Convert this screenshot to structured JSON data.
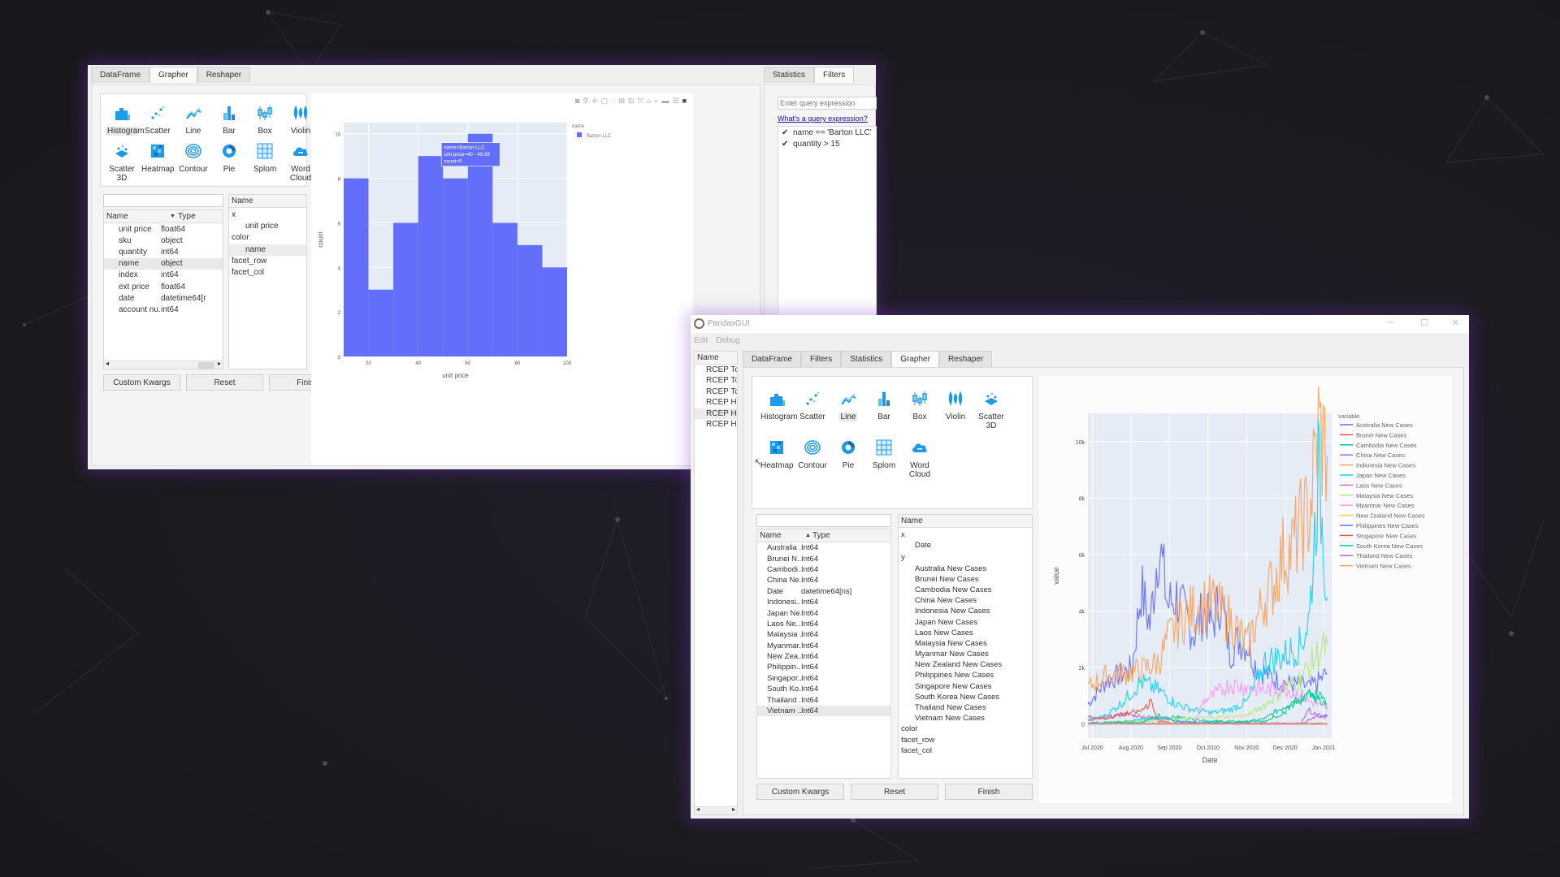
{
  "window1": {
    "tabs": [
      {
        "label": "DataFrame",
        "active": false
      },
      {
        "label": "Grapher",
        "active": true
      },
      {
        "label": "Reshaper",
        "active": false
      }
    ],
    "right_tabs": [
      {
        "label": "Statistics",
        "active": false
      },
      {
        "label": "Filters",
        "active": true
      }
    ],
    "chart_types": [
      {
        "label": "Histogram",
        "icon": "histogram-icon",
        "selected": true
      },
      {
        "label": "Scatter",
        "icon": "scatter-icon"
      },
      {
        "label": "Line",
        "icon": "line-icon"
      },
      {
        "label": "Bar",
        "icon": "bar-icon"
      },
      {
        "label": "Box",
        "icon": "box-icon"
      },
      {
        "label": "Violin",
        "icon": "violin-icon"
      },
      {
        "label": "Scatter 3D",
        "icon": "scatter3d-icon"
      },
      {
        "label": "Heatmap",
        "icon": "heatmap-icon"
      },
      {
        "label": "Contour",
        "icon": "contour-icon"
      },
      {
        "label": "Pie",
        "icon": "pie-icon"
      },
      {
        "label": "Splom",
        "icon": "splom-icon"
      },
      {
        "label": "Word Cloud",
        "icon": "wordcloud-icon"
      }
    ],
    "column_search": {
      "value": "",
      "placeholder": ""
    },
    "columns_header": {
      "name": "Name",
      "type": "Type",
      "sort": "descending"
    },
    "columns": [
      {
        "name": "unit price",
        "type": "float64"
      },
      {
        "name": "sku",
        "type": "object"
      },
      {
        "name": "quantity",
        "type": "int64"
      },
      {
        "name": "name",
        "type": "object",
        "highlighted": true
      },
      {
        "name": "index",
        "type": "int64"
      },
      {
        "name": "ext price",
        "type": "float64"
      },
      {
        "name": "date",
        "type": "datetime64[r"
      },
      {
        "name": "account nu...",
        "type": "int64"
      }
    ],
    "dragger_header": "Name",
    "dragger_items": [
      {
        "label": "x",
        "child": false
      },
      {
        "label": "unit price",
        "child": true
      },
      {
        "label": "color",
        "child": false
      },
      {
        "label": "name",
        "child": true,
        "highlighted": true
      },
      {
        "label": "facet_row",
        "child": false
      },
      {
        "label": "facet_col",
        "child": false
      }
    ],
    "buttons": {
      "custom_kwargs": "Custom Kwargs",
      "reset": "Reset",
      "finish": "Finish"
    },
    "filters": {
      "query_placeholder": "Enter query expression",
      "help_link": "What's a query expression?",
      "items": [
        {
          "label": "name == 'Barton LLC'",
          "checked": true
        },
        {
          "label": "quantity > 15",
          "checked": true
        }
      ]
    },
    "plot_toolbar": [
      "camera-icon",
      "zoom-icon",
      "pan-icon",
      "box-select-icon",
      "lasso-icon",
      "zoom-in-icon",
      "zoom-out-icon",
      "autoscale-icon",
      "reset-axes-icon",
      "spike-lines-icon",
      "hover-closest-icon",
      "hover-compare-icon",
      "plotly-logo-icon"
    ],
    "tooltip": {
      "line1": "name=Barton LLC",
      "line2": "unit price=40 - 49.99",
      "line3": "count=9"
    }
  },
  "window2": {
    "title": "PandasGUI",
    "menu": [
      "Edit",
      "Debug"
    ],
    "controls": {
      "minimize": "—",
      "maximize": "☐",
      "close": "✕"
    },
    "dataframes_header": "Name",
    "dataframes": [
      "RCEP Toc",
      "RCEP Toc",
      "RCEP Toc",
      "RCEP His",
      "RCEP His",
      "RCEP His"
    ],
    "highlighted_dataframe": 4,
    "tabs": [
      {
        "label": "DataFrame",
        "active": false
      },
      {
        "label": "Filters",
        "active": false
      },
      {
        "label": "Statistics",
        "active": false
      },
      {
        "label": "Grapher",
        "active": true
      },
      {
        "label": "Reshaper",
        "active": false
      }
    ],
    "chart_types": [
      {
        "label": "Histogram",
        "icon": "histogram-icon"
      },
      {
        "label": "Scatter",
        "icon": "scatter-icon"
      },
      {
        "label": "Line",
        "icon": "line-icon",
        "selected": true
      },
      {
        "label": "Bar",
        "icon": "bar-icon"
      },
      {
        "label": "Box",
        "icon": "box-icon"
      },
      {
        "label": "Violin",
        "icon": "violin-icon"
      },
      {
        "label": "Scatter 3D",
        "icon": "scatter3d-icon"
      },
      {
        "label": "Heatmap",
        "icon": "heatmap-icon"
      },
      {
        "label": "Contour",
        "icon": "contour-icon"
      },
      {
        "label": "Pie",
        "icon": "pie-icon"
      },
      {
        "label": "Splom",
        "icon": "splom-icon"
      },
      {
        "label": "Word Cloud",
        "icon": "wordcloud-icon"
      }
    ],
    "column_search": {
      "value": "",
      "placeholder": ""
    },
    "columns_header": {
      "name": "Name",
      "type": "Type",
      "sort": "ascending"
    },
    "columns": [
      {
        "name": "Australia ...",
        "type": "Int64"
      },
      {
        "name": "Brunei N...",
        "type": "Int64"
      },
      {
        "name": "Cambodi...",
        "type": "Int64"
      },
      {
        "name": "China Ne...",
        "type": "Int64"
      },
      {
        "name": "Date",
        "type": "datetime64[ns]"
      },
      {
        "name": "Indonesi...",
        "type": "Int64"
      },
      {
        "name": "Japan Ne...",
        "type": "Int64"
      },
      {
        "name": "Laos Ne...",
        "type": "Int64"
      },
      {
        "name": "Malaysia ...",
        "type": "Int64"
      },
      {
        "name": "Myanmar...",
        "type": "Int64"
      },
      {
        "name": "New Zea...",
        "type": "Int64"
      },
      {
        "name": "Philippin...",
        "type": "Int64"
      },
      {
        "name": "Singapor...",
        "type": "Int64"
      },
      {
        "name": "South Ko...",
        "type": "Int64"
      },
      {
        "name": "Thailand ...",
        "type": "Int64"
      },
      {
        "name": "Vietnam ...",
        "type": "Int64",
        "highlighted": true
      }
    ],
    "dragger_header": "Name",
    "dragger_items": [
      {
        "label": "x",
        "child": false
      },
      {
        "label": "Date",
        "child": true
      },
      {
        "label": "y",
        "child": false
      },
      {
        "label": "Australia New Cases",
        "child": true
      },
      {
        "label": "Brunei New Cases",
        "child": true
      },
      {
        "label": "Cambodia New Cases",
        "child": true
      },
      {
        "label": "China New Cases",
        "child": true
      },
      {
        "label": "Indonesia New Cases",
        "child": true
      },
      {
        "label": "Japan New Cases",
        "child": true
      },
      {
        "label": "Laos New Cases",
        "child": true
      },
      {
        "label": "Malaysia New Cases",
        "child": true
      },
      {
        "label": "Myanmar New Cases",
        "child": true
      },
      {
        "label": "New Zealand New Cases",
        "child": true
      },
      {
        "label": "Philippines New Cases",
        "child": true
      },
      {
        "label": "Singapore New Cases",
        "child": true
      },
      {
        "label": "South Korea New Cases",
        "child": true
      },
      {
        "label": "Thailand New Cases",
        "child": true
      },
      {
        "label": "Vietnam New Cases",
        "child": true
      },
      {
        "label": "color",
        "child": false
      },
      {
        "label": "facet_row",
        "child": false
      },
      {
        "label": "facet_col",
        "child": false
      }
    ],
    "buttons": {
      "custom_kwargs": "Custom Kwargs",
      "reset": "Reset",
      "finish": "Finish"
    }
  },
  "colors": {
    "accent_icon": "#1e9be8",
    "plotly_blue": "#636efa",
    "plot_bg": "#e5ecf6",
    "link": "#1a0dab"
  },
  "chart_data": [
    {
      "type": "bar",
      "subtype": "histogram",
      "title": "",
      "xlabel": "unit price",
      "ylabel": "count",
      "bins": [
        [
          10,
          20
        ],
        [
          20,
          30
        ],
        [
          30,
          40
        ],
        [
          40,
          50
        ],
        [
          50,
          60
        ],
        [
          60,
          70
        ],
        [
          70,
          80
        ],
        [
          80,
          90
        ],
        [
          90,
          100
        ]
      ],
      "values": [
        8,
        3,
        6,
        9,
        8,
        10,
        6,
        5,
        4
      ],
      "xlim": [
        10,
        100
      ],
      "ylim": [
        0,
        10.5
      ],
      "xticks": [
        20,
        40,
        60,
        80,
        100
      ],
      "yticks": [
        0,
        2,
        4,
        6,
        8,
        10
      ],
      "legend_title": "name",
      "legend": [
        {
          "name": "Barton LLC",
          "color": "#636efa"
        }
      ],
      "legend_position": "top-right",
      "grid": true
    },
    {
      "type": "line",
      "title": "",
      "xlabel": "Date",
      "ylabel": "value",
      "x_range": [
        "2020-06-28",
        "2021-01-10"
      ],
      "xticks": [
        "Jul 2020",
        "Aug 2020",
        "Sep 2020",
        "Oct 2020",
        "Nov 2020",
        "Dec 2020",
        "Jan 2021"
      ],
      "yticks": [
        "0",
        "2k",
        "4k",
        "6k",
        "8k",
        "10k"
      ],
      "ylim": [
        -500,
        11000
      ],
      "legend_title": "variable",
      "legend_position": "right",
      "grid": true,
      "series": [
        {
          "name": "Australia New Cases",
          "color": "#636efa",
          "x_weeks": [
            0,
            2,
            4,
            5,
            6,
            7,
            8,
            9,
            10,
            11,
            12,
            13,
            14,
            15,
            16,
            17,
            18,
            19,
            20,
            21,
            22,
            23,
            24,
            25,
            26,
            27
          ],
          "values": [
            700,
            1500,
            1800,
            2000,
            4800,
            3500,
            6500,
            4200,
            4500,
            3800,
            3200,
            4000,
            3500,
            4500,
            2500,
            3000,
            2800,
            2000,
            1800,
            1600,
            1500,
            1400,
            1400,
            1300,
            1500,
            1800
          ]
        },
        {
          "name": "Brunei New Cases",
          "color": "#ef553b",
          "x_weeks": [
            0,
            27
          ],
          "values": [
            0,
            0
          ]
        },
        {
          "name": "Cambodia New Cases",
          "color": "#00cc96",
          "x_weeks": [
            0,
            10,
            14,
            18,
            20,
            22,
            24,
            26,
            27
          ],
          "values": [
            0,
            250,
            100,
            80,
            200,
            600,
            1000,
            1000,
            600
          ]
        },
        {
          "name": "China New Cases",
          "color": "#ab63fa",
          "x_weeks": [
            0,
            4,
            8,
            12,
            24,
            26,
            27
          ],
          "values": [
            100,
            350,
            200,
            50,
            0,
            300,
            250
          ]
        },
        {
          "name": "Indonesia New Cases",
          "color": "#ffa15a",
          "x_weeks": [
            0,
            2,
            4,
            6,
            8,
            9,
            10,
            12,
            14,
            16,
            18,
            20,
            21,
            22,
            23,
            24,
            25,
            26,
            27
          ],
          "values": [
            1300,
            1700,
            1800,
            1900,
            2200,
            3000,
            3500,
            4100,
            4300,
            3700,
            2800,
            4500,
            5000,
            6000,
            6200,
            7000,
            7500,
            10500,
            9500
          ]
        },
        {
          "name": "Japan New Cases",
          "color": "#19d3f3",
          "x_weeks": [
            0,
            2,
            4,
            6,
            8,
            10,
            12,
            14,
            16,
            18,
            20,
            22,
            24,
            25,
            26,
            27
          ],
          "values": [
            150,
            300,
            800,
            1500,
            1200,
            700,
            500,
            400,
            500,
            800,
            2200,
            2400,
            2800,
            3800,
            9000,
            4500
          ]
        },
        {
          "name": "Laos New Cases",
          "color": "#ff6692",
          "x_weeks": [
            0,
            27
          ],
          "values": [
            0,
            0
          ]
        },
        {
          "name": "Malaysia New Cases",
          "color": "#b6e880",
          "x_weeks": [
            0,
            18,
            20,
            22,
            24,
            26,
            27
          ],
          "values": [
            0,
            300,
            700,
            1200,
            1600,
            2500,
            2800
          ]
        },
        {
          "name": "Myanmar New Cases",
          "color": "#ff97ff",
          "x_weeks": [
            0,
            12,
            13,
            14,
            16,
            18,
            20,
            22,
            24,
            25,
            26,
            27
          ],
          "values": [
            0,
            0,
            800,
            1000,
            1400,
            1300,
            1200,
            1300,
            1000,
            800,
            700,
            500
          ]
        },
        {
          "name": "New Zealand New Cases",
          "color": "#fecb52",
          "x_weeks": [
            0,
            27
          ],
          "values": [
            0,
            0
          ]
        },
        {
          "name": "Philippines New Cases",
          "color": "#636efa",
          "x_weeks": [
            0,
            27
          ],
          "values": [
            0,
            0
          ]
        },
        {
          "name": "Singapore New Cases",
          "color": "#ef553b",
          "x_weeks": [
            0,
            2,
            4,
            6,
            7,
            8,
            10,
            27
          ],
          "values": [
            250,
            200,
            350,
            450,
            800,
            100,
            0,
            0
          ]
        },
        {
          "name": "South Korea New Cases",
          "color": "#00cc96",
          "x_weeks": [
            0,
            6,
            8,
            10,
            14,
            20,
            22,
            24,
            26,
            27
          ],
          "values": [
            50,
            50,
            300,
            80,
            50,
            100,
            400,
            900,
            1000,
            700
          ]
        },
        {
          "name": "Thailand New Cases",
          "color": "#ab63fa",
          "x_weeks": [
            0,
            24,
            25,
            26,
            27
          ],
          "values": [
            0,
            0,
            500,
            200,
            300
          ]
        },
        {
          "name": "Vietnam New Cases",
          "color": "#ffa15a",
          "x_weeks": [
            0,
            27
          ],
          "values": [
            0,
            0
          ]
        }
      ]
    }
  ]
}
